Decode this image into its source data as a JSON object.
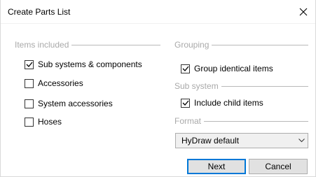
{
  "window": {
    "title": "Create Parts List",
    "close_icon": "close-icon"
  },
  "items_included": {
    "header": "Items included",
    "options": [
      {
        "label": "Sub systems & components",
        "checked": true
      },
      {
        "label": "Accessories",
        "checked": false
      },
      {
        "label": "System accessories",
        "checked": false
      },
      {
        "label": "Hoses",
        "checked": false
      }
    ]
  },
  "grouping": {
    "header": "Grouping",
    "option": {
      "label": "Group identical items",
      "checked": true
    }
  },
  "sub_system": {
    "header": "Sub system",
    "option": {
      "label": "Include child items",
      "checked": true
    }
  },
  "format": {
    "header": "Format",
    "selected": "HyDraw default"
  },
  "buttons": {
    "next": "Next",
    "cancel": "Cancel"
  }
}
